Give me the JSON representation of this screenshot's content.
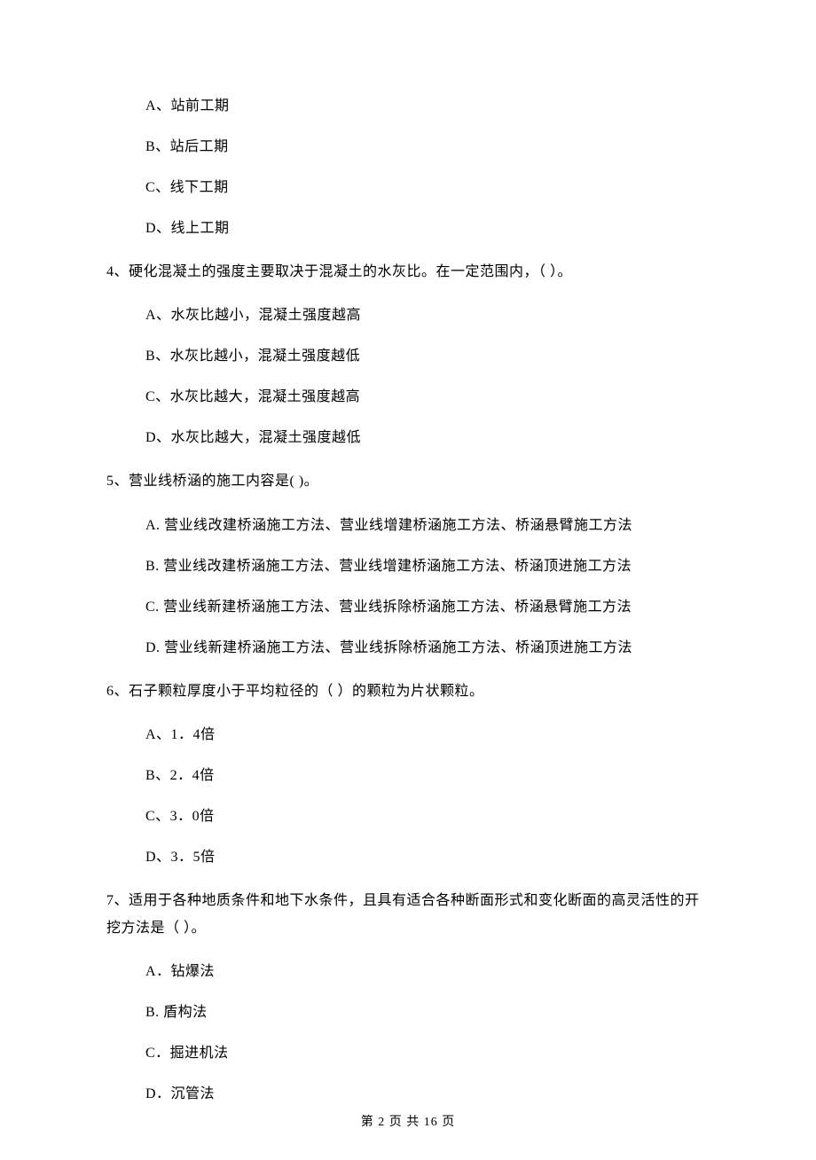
{
  "q3": {
    "options": {
      "a": "A、站前工期",
      "b": "B、站后工期",
      "c": "C、线下工期",
      "d": "D、线上工期"
    }
  },
  "q4": {
    "stem": "4、硬化混凝土的强度主要取决于混凝土的水灰比。在一定范围内，（    ）。",
    "options": {
      "a": "A、水灰比越小，混凝土强度越高",
      "b": "B、水灰比越小，混凝土强度越低",
      "c": "C、水灰比越大，混凝土强度越高",
      "d": "D、水灰比越大，混凝土强度越低"
    }
  },
  "q5": {
    "stem": "5、营业线桥涵的施工内容是(    )。",
    "options": {
      "a": "A. 营业线改建桥涵施工方法、营业线增建桥涵施工方法、桥涵悬臂施工方法",
      "b": "B. 营业线改建桥涵施工方法、营业线增建桥涵施工方法、桥涵顶进施工方法",
      "c": "C. 营业线新建桥涵施工方法、营业线拆除桥涵施工方法、桥涵悬臂施工方法",
      "d": "D. 营业线新建桥涵施工方法、营业线拆除桥涵施工方法、桥涵顶进施工方法"
    }
  },
  "q6": {
    "stem": "6、石子颗粒厚度小于平均粒径的（    ）的颗粒为片状颗粒。",
    "options": {
      "a": "A、1．4倍",
      "b": "B、2．4倍",
      "c": "C、3．0倍",
      "d": "D、3．5倍"
    }
  },
  "q7": {
    "stem": "7、适用于各种地质条件和地下水条件，且具有适合各种断面形式和变化断面的高灵活性的开挖方法是（    ）。",
    "options": {
      "a": "A．钻爆法",
      "b": "B. 盾构法",
      "c": "C．掘进机法",
      "d": "D．沉管法"
    }
  },
  "footer": "第 2 页 共 16 页"
}
